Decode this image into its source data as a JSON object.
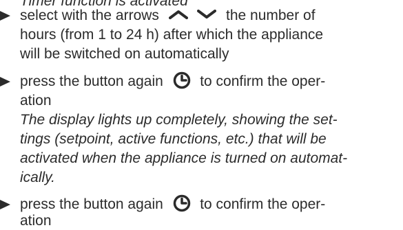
{
  "doc": {
    "clipped_line": "Timer function is activated",
    "bullet1": {
      "line1_before": "select with the arrows",
      "line1_after": "the number of",
      "line2": "hours (from 1 to 24 h) after which the appliance",
      "line3": "will be switched on automatically"
    },
    "bullet2": {
      "line1_before": "press the button again",
      "line1_after": "to confirm the oper-",
      "line2": "ation"
    },
    "note": {
      "line1": "The display lights up completely, showing the set-",
      "line2": "tings (setpoint, active functions, etc.) that will be",
      "line3": "activated when the appliance is turned on automat-",
      "line4": "ically."
    },
    "bullet3": {
      "line1_before": "press the button again",
      "line1_after": "to confirm the oper-",
      "line2": "ation"
    }
  },
  "icons": {
    "bullet": "triangle-bullet-icon",
    "up": "arrow-up-icon",
    "down": "arrow-down-icon",
    "timer": "timer-clock-icon"
  }
}
